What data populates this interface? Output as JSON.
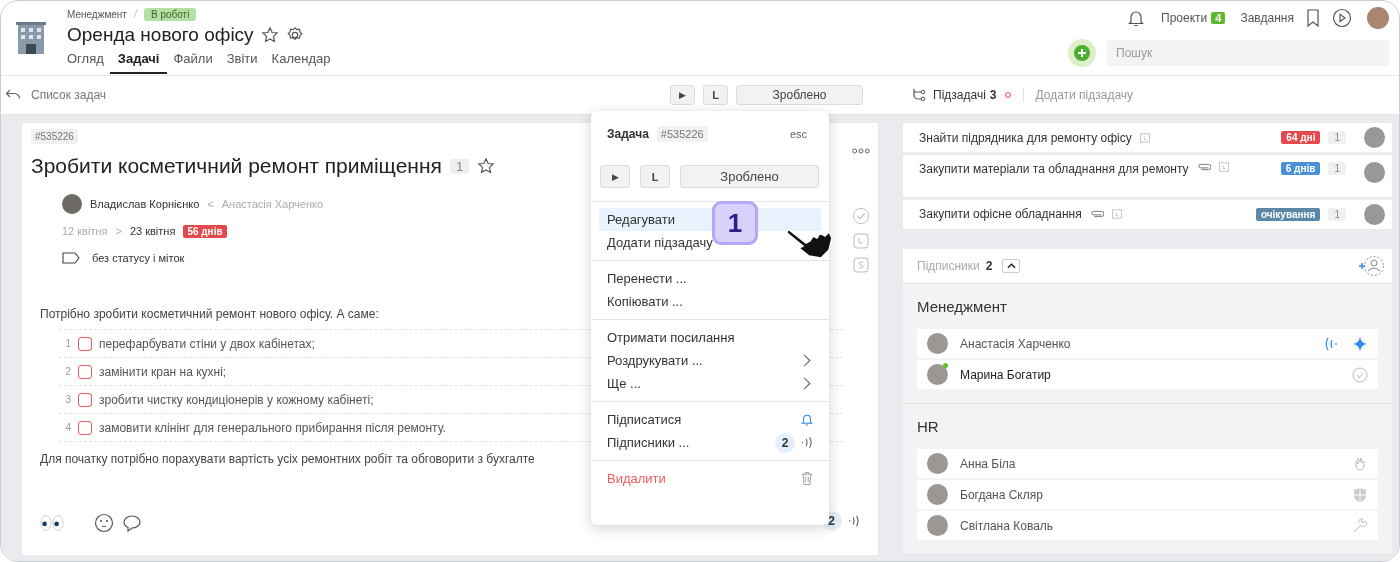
{
  "header": {
    "breadcrumb": "Менеджмент",
    "status": "В роботі",
    "title": "Оренда нового офісу",
    "tabs": [
      {
        "label": "Огляд",
        "selected": false
      },
      {
        "label": "Задачі",
        "selected": true
      },
      {
        "label": "Файли",
        "selected": false
      },
      {
        "label": "Звіти",
        "selected": false
      },
      {
        "label": "Календар",
        "selected": false
      }
    ],
    "projects_label": "Проекти",
    "projects_count": "4",
    "tasks_label": "Завдання",
    "search": {
      "placeholder": "Пошук"
    }
  },
  "toolbar": {
    "back_label": "Список задач",
    "play": "▶",
    "timer": "L",
    "done": "Зроблено",
    "subtasks_label": "Підзадачі",
    "subtasks_count": "3",
    "add_subtask": "Додати підзадачу"
  },
  "task": {
    "id": "#535226",
    "title": "Зробити косметичний ремонт приміщення",
    "count": "1",
    "assignee": "Владислав Корнієнко",
    "separator": "<",
    "author": "Анастасія Харченко",
    "start": "12 квітня",
    "arrow": ">",
    "end": "23 квітня",
    "overdue": "56 днів",
    "tags": "без статусу і міток",
    "intro": "Потрібно зробити косметичний ремонт нового офісу. А саме:",
    "checklist": [
      {
        "number": "1",
        "text": "перефарбувати стіни у двох кабінетах;",
        "checked": false
      },
      {
        "number": "2",
        "text": "замінити кран на кухні;",
        "checked": false
      },
      {
        "number": "3",
        "text": "зробити чистку кондиціонерів у кожному кабінеті;",
        "checked": false
      },
      {
        "number": "4",
        "text": "замовити клінінг для генерального прибирання після ремонту.",
        "checked": false
      }
    ],
    "outro": "Для початку потрібно порахувати вартість усіх ремонтних робіт та обговорити з бухгалте",
    "subscribers_count": "2"
  },
  "menu": {
    "title": "Задача",
    "id": "#535226",
    "esc": "esc",
    "play": "▶",
    "timer": "L",
    "done": "Зроблено",
    "groups": [
      [
        {
          "label": "Редагувати",
          "kind": "plain",
          "selected": true
        },
        {
          "label": "Додати підзадачу",
          "kind": "plain",
          "selected": false
        }
      ],
      [
        {
          "label": "Перенести ...",
          "kind": "plain",
          "selected": false
        },
        {
          "label": "Копіювати ...",
          "kind": "plain",
          "selected": false
        }
      ],
      [
        {
          "label": "Отримати посилання",
          "kind": "plain",
          "selected": false
        },
        {
          "label": "Роздрукувати ...",
          "kind": "submenu",
          "selected": false
        },
        {
          "label": "Ще ...",
          "kind": "submenu",
          "selected": false
        }
      ],
      [
        {
          "label": "Підписатися",
          "kind": "subscribe",
          "selected": false
        },
        {
          "label": "Підписники ...",
          "kind": "subscribers",
          "count": "2",
          "selected": false
        }
      ],
      [
        {
          "label": "Видалити",
          "kind": "delete",
          "selected": false
        }
      ]
    ],
    "callout": "1"
  },
  "subtasks": [
    {
      "title": "Знайти підрядника для ремонту офісу",
      "attachment": false,
      "badge": "64 дні",
      "color": "#e5484d",
      "count": "1"
    },
    {
      "title": "Закупити матеріали та обладнання для ремонту",
      "attachment": true,
      "badge": "6 днів",
      "color": "#4a90d9",
      "count": "1"
    },
    {
      "title": "Закупити офісне обладнання",
      "attachment": true,
      "badge": "очікування",
      "color": "#5b87a8",
      "count": "1"
    }
  ],
  "subscribers": {
    "label": "Підписники",
    "count": "2",
    "groups": [
      {
        "name": "Менеджмент",
        "people": [
          {
            "name": "Анастасія Харченко",
            "online": false,
            "kind": "star"
          },
          {
            "name": "Марина Богатир",
            "online": true,
            "kind": "check"
          }
        ]
      },
      {
        "name": "HR",
        "people": [
          {
            "name": "Анна Біла",
            "online": false,
            "kind": "hand"
          },
          {
            "name": "Богдана Скляр",
            "online": false,
            "kind": "shield"
          },
          {
            "name": "Світлана Коваль",
            "online": false,
            "kind": "wrench"
          }
        ]
      }
    ]
  }
}
